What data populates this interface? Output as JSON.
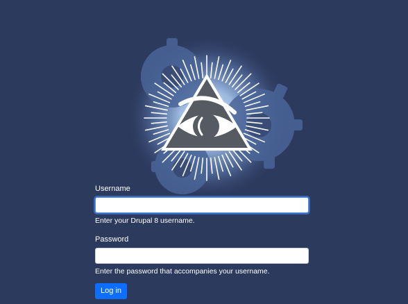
{
  "colors": {
    "background": "#2c3a5e",
    "glow": "#a9c7ee",
    "gear": "#4a6598",
    "triangle": "#555a63",
    "button": "#0d6efd"
  },
  "logo": {
    "icon": "all-seeing-eye-icon"
  },
  "login_form": {
    "username_label": "Username",
    "username_value": "",
    "username_help": "Enter your Drupal 8 username.",
    "password_label": "Password",
    "password_value": "",
    "password_help": "Enter the password that accompanies your username.",
    "submit_label": "Log in"
  }
}
